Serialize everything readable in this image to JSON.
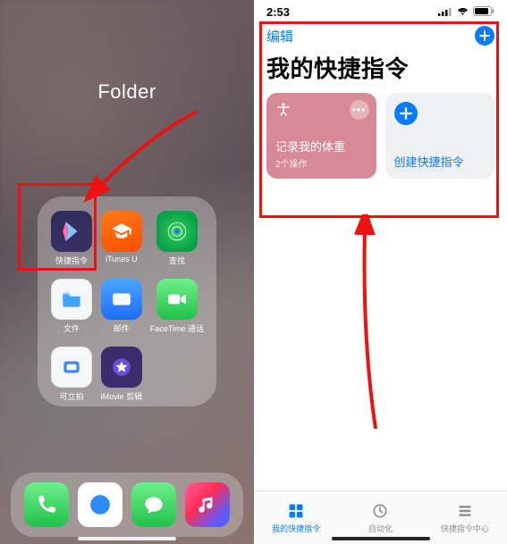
{
  "left": {
    "folder_title": "Folder",
    "apps": [
      {
        "id": "shortcuts",
        "label": "快捷指令"
      },
      {
        "id": "itunesu",
        "label": "iTunes U"
      },
      {
        "id": "find",
        "label": "查找"
      },
      {
        "id": "files",
        "label": "文件"
      },
      {
        "id": "mail",
        "label": "邮件"
      },
      {
        "id": "facetime",
        "label": "FaceTime 通话"
      },
      {
        "id": "clips",
        "label": "可立拍"
      },
      {
        "id": "imovie",
        "label": "iMovie 剪辑"
      }
    ]
  },
  "right": {
    "status_time": "2:53",
    "edit_label": "编辑",
    "page_title": "我的快捷指令",
    "card_weight_title": "记录我的体重",
    "card_weight_sub": "2个操作",
    "card_create_label": "创建快捷指令",
    "tabs": {
      "shortcuts": "我的快捷指令",
      "automation": "自动化",
      "gallery": "快捷指令中心"
    }
  },
  "colors": {
    "accent": "#0a7aff",
    "annotation": "#e11111",
    "card_pink": "#d78a96"
  }
}
